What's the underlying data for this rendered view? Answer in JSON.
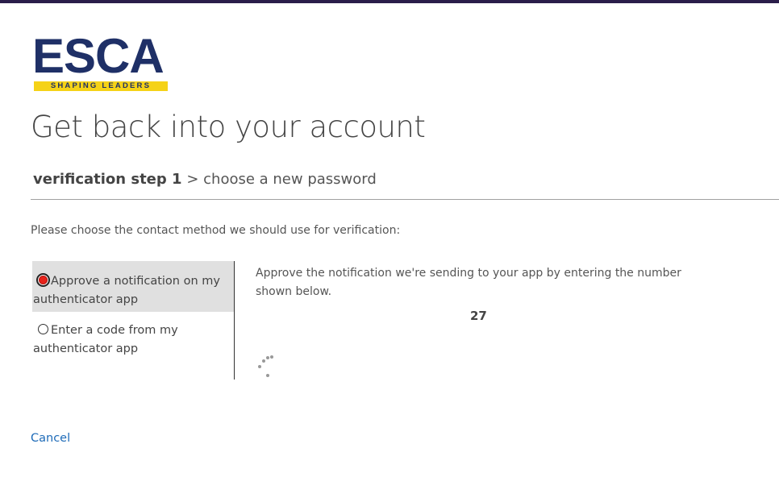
{
  "brand": {
    "logo_name": "ESCA",
    "logo_tagline": "SHAPING LEADERS",
    "colors": {
      "navy": "#1f3067",
      "yellow": "#f5d217",
      "link": "#1e6bb8",
      "radio_selected": "#e8221a"
    }
  },
  "page": {
    "title": "Get back into your account"
  },
  "steps": {
    "current": "verification step 1",
    "separator": ">",
    "next": "choose a new password"
  },
  "prompt": "Please choose the contact method we should use for verification:",
  "methods": [
    {
      "label": "Approve a notification on my authenticator app",
      "selected": true
    },
    {
      "label": "Enter a code from my authenticator app",
      "selected": false
    }
  ],
  "detail": {
    "instruction": "Approve the notification we're sending to your app by entering the number shown below.",
    "number": "27",
    "loading_icon": "spinner-icon"
  },
  "actions": {
    "cancel_label": "Cancel"
  }
}
